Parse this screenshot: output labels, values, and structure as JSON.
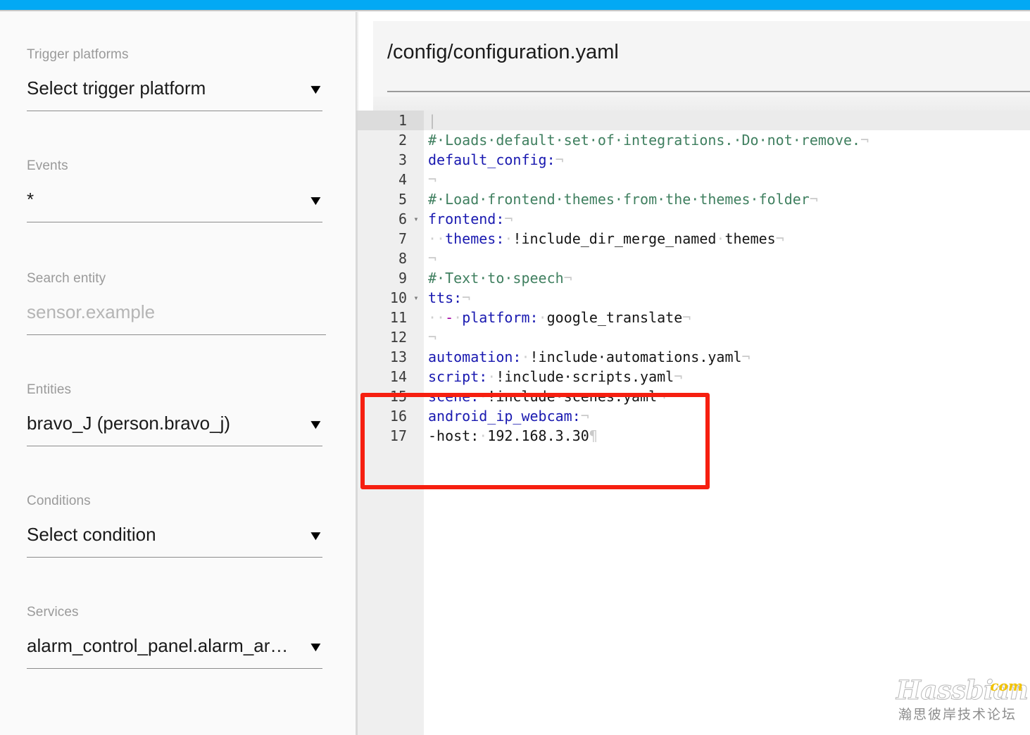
{
  "theme": {
    "accent": "#03A9F4",
    "sidebar_bg": "#fafafa",
    "editor_bg": "#ffffff",
    "gutter_bg": "#efefef",
    "annotation_color": "#f61f10",
    "comment_color": "#3f7f5f",
    "key_color": "#1919b0"
  },
  "sidebar": {
    "fields": [
      {
        "label": "Trigger platforms",
        "value": "Select trigger platform",
        "is_placeholder": false,
        "caret": "▼",
        "name": "trigger-platform"
      },
      {
        "label": "Events",
        "value": "*",
        "is_placeholder": false,
        "caret": "▼",
        "name": "events"
      },
      {
        "label": "Search entity",
        "value": "sensor.example",
        "is_placeholder": true,
        "caret": "",
        "name": "search-entity"
      },
      {
        "label": "Entities",
        "value": "bravo_J (person.bravo_j)",
        "is_placeholder": false,
        "caret": "▼",
        "name": "entities"
      },
      {
        "label": "Conditions",
        "value": "Select condition",
        "is_placeholder": false,
        "caret": "▼",
        "name": "conditions"
      },
      {
        "label": "Services",
        "value": "alarm_control_panel.alarm_ar…",
        "is_placeholder": false,
        "caret": "▼",
        "name": "services"
      }
    ]
  },
  "editor": {
    "title": "/config/configuration.yaml",
    "active_line": 1,
    "lines": [
      {
        "n": "1",
        "fold": "",
        "tokens": [
          {
            "t": "|",
            "c": "tok-caret"
          }
        ]
      },
      {
        "n": "2",
        "fold": "",
        "tokens": [
          {
            "t": "#·Loads·default·set·of·integrations.·Do·not·remove.",
            "c": "tok-com"
          },
          {
            "t": "¬",
            "c": "tok-eol"
          }
        ]
      },
      {
        "n": "3",
        "fold": "",
        "tokens": [
          {
            "t": "default_config:",
            "c": "tok-key"
          },
          {
            "t": "¬",
            "c": "tok-eol"
          }
        ]
      },
      {
        "n": "4",
        "fold": "",
        "tokens": [
          {
            "t": "¬",
            "c": "tok-eol"
          }
        ]
      },
      {
        "n": "5",
        "fold": "",
        "tokens": [
          {
            "t": "#·Load·frontend·themes·from·the·themes·folder",
            "c": "tok-com"
          },
          {
            "t": "¬",
            "c": "tok-eol"
          }
        ]
      },
      {
        "n": "6",
        "fold": "▾",
        "tokens": [
          {
            "t": "frontend:",
            "c": "tok-key"
          },
          {
            "t": "¬",
            "c": "tok-eol"
          }
        ]
      },
      {
        "n": "7",
        "fold": "",
        "tokens": [
          {
            "t": "··",
            "c": "tok-ws"
          },
          {
            "t": "themes:",
            "c": "tok-key"
          },
          {
            "t": "·",
            "c": "tok-ws"
          },
          {
            "t": "!include_dir_merge_named",
            "c": "tok-val"
          },
          {
            "t": "·",
            "c": "tok-ws"
          },
          {
            "t": "themes",
            "c": "tok-val"
          },
          {
            "t": "¬",
            "c": "tok-eol"
          }
        ]
      },
      {
        "n": "8",
        "fold": "",
        "tokens": [
          {
            "t": "¬",
            "c": "tok-eol"
          }
        ]
      },
      {
        "n": "9",
        "fold": "",
        "tokens": [
          {
            "t": "#·Text·to·speech",
            "c": "tok-com"
          },
          {
            "t": "¬",
            "c": "tok-eol"
          }
        ]
      },
      {
        "n": "10",
        "fold": "▾",
        "tokens": [
          {
            "t": "tts:",
            "c": "tok-key"
          },
          {
            "t": "¬",
            "c": "tok-eol"
          }
        ]
      },
      {
        "n": "11",
        "fold": "",
        "tokens": [
          {
            "t": "··",
            "c": "tok-ws"
          },
          {
            "t": "-",
            "c": "tok-dash"
          },
          {
            "t": "·",
            "c": "tok-ws"
          },
          {
            "t": "platform:",
            "c": "tok-key"
          },
          {
            "t": "·",
            "c": "tok-ws"
          },
          {
            "t": "google_translate",
            "c": "tok-val"
          },
          {
            "t": "¬",
            "c": "tok-eol"
          }
        ]
      },
      {
        "n": "12",
        "fold": "",
        "tokens": [
          {
            "t": "¬",
            "c": "tok-eol"
          }
        ]
      },
      {
        "n": "13",
        "fold": "",
        "tokens": [
          {
            "t": "automation:",
            "c": "tok-key"
          },
          {
            "t": "·",
            "c": "tok-ws"
          },
          {
            "t": "!include·automations.yaml",
            "c": "tok-val"
          },
          {
            "t": "¬",
            "c": "tok-eol"
          }
        ]
      },
      {
        "n": "14",
        "fold": "",
        "tokens": [
          {
            "t": "script:",
            "c": "tok-key"
          },
          {
            "t": "·",
            "c": "tok-ws"
          },
          {
            "t": "!include·scripts.yaml",
            "c": "tok-val"
          },
          {
            "t": "¬",
            "c": "tok-eol"
          }
        ]
      },
      {
        "n": "15",
        "fold": "",
        "tokens": [
          {
            "t": "scene:",
            "c": "tok-key"
          },
          {
            "t": "·",
            "c": "tok-ws"
          },
          {
            "t": "!include·scenes.yaml",
            "c": "tok-val"
          },
          {
            "t": "¬",
            "c": "tok-eol"
          }
        ]
      },
      {
        "n": "16",
        "fold": "",
        "tokens": [
          {
            "t": "android_ip_webcam:",
            "c": "tok-key"
          },
          {
            "t": "¬",
            "c": "tok-eol"
          }
        ]
      },
      {
        "n": "17",
        "fold": "",
        "tokens": [
          {
            "t": "-host:",
            "c": "tok-val"
          },
          {
            "t": "·",
            "c": "tok-ws"
          },
          {
            "t": "192.168.3.30",
            "c": "tok-val"
          },
          {
            "t": "¶",
            "c": "tok-eol"
          }
        ]
      }
    ]
  },
  "annotation": {
    "label": "red-highlight-box",
    "covers_lines": [
      "15",
      "16",
      "17"
    ]
  },
  "watermark": {
    "brand": "Hassbian",
    "tld": "com",
    "subtitle": "瀚思彼岸技术论坛"
  }
}
